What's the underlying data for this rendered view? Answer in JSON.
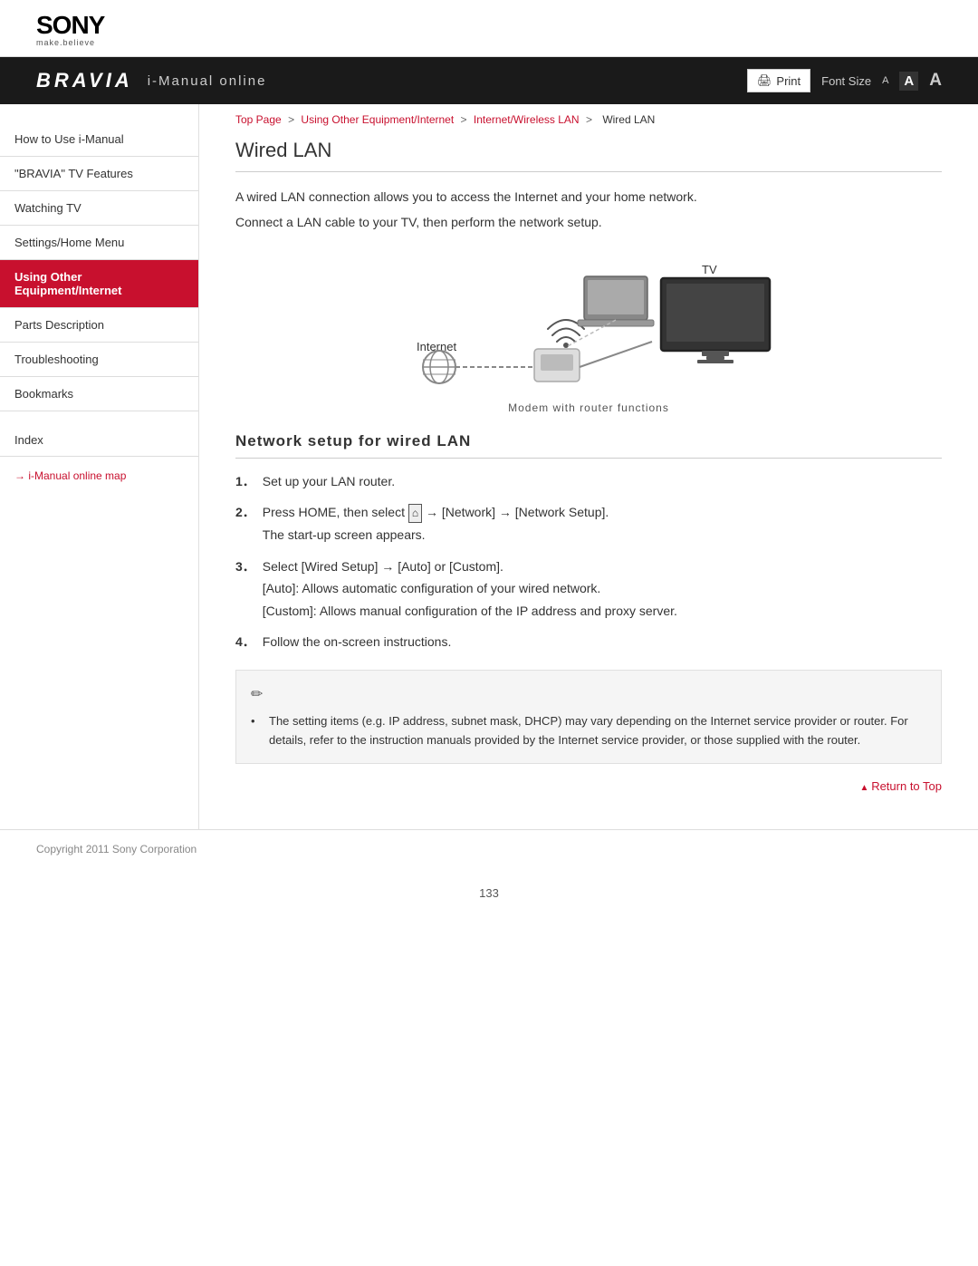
{
  "header": {
    "sony_wordmark": "SONY",
    "sony_tagline": "make.believe"
  },
  "navbar": {
    "bravia_logo": "BRAVIA",
    "title": "i-Manual online",
    "print_label": "Print",
    "font_size_label": "Font Size",
    "font_size_small": "A",
    "font_size_medium": "A",
    "font_size_large": "A"
  },
  "breadcrumb": {
    "top_page": "Top Page",
    "separator1": ">",
    "using_other": "Using Other Equipment/Internet",
    "separator2": ">",
    "internet_wireless": "Internet/Wireless LAN",
    "separator3": ">",
    "current": "Wired LAN"
  },
  "sidebar": {
    "items": [
      {
        "id": "how-to-use",
        "label": "How to Use i-Manual",
        "active": false
      },
      {
        "id": "bravia-features",
        "label": "\"BRAVIA\" TV Features",
        "active": false
      },
      {
        "id": "watching-tv",
        "label": "Watching TV",
        "active": false
      },
      {
        "id": "settings-home",
        "label": "Settings/Home Menu",
        "active": false
      },
      {
        "id": "using-other",
        "label": "Using Other Equipment/Internet",
        "active": true
      },
      {
        "id": "parts-description",
        "label": "Parts Description",
        "active": false
      },
      {
        "id": "troubleshooting",
        "label": "Troubleshooting",
        "active": false
      },
      {
        "id": "bookmarks",
        "label": "Bookmarks",
        "active": false
      }
    ],
    "index_label": "Index",
    "map_link": "→ i-Manual online map"
  },
  "content": {
    "page_title": "Wired LAN",
    "intro1": "A wired LAN connection allows you to access the Internet and your home network.",
    "intro2": "Connect a LAN cable to your TV, then perform the network setup.",
    "diagram": {
      "caption": "Modem with router functions",
      "internet_label": "Internet",
      "tv_label": "TV"
    },
    "section_heading": "Network setup for wired LAN",
    "steps": [
      {
        "num": "1．",
        "text": "Set up your LAN router."
      },
      {
        "num": "2．",
        "text": "Press HOME, then select",
        "sub": "→ [Network] → [Network Setup].\nThe start-up screen appears."
      },
      {
        "num": "3．",
        "text": "Select [Wired Setup] → [Auto] or [Custom].",
        "sub": "[Auto]: Allows automatic configuration of your wired network.\n[Custom]: Allows manual configuration of the IP address and proxy server."
      },
      {
        "num": "4．",
        "text": "Follow the on-screen instructions."
      }
    ],
    "note": {
      "bullet": "The setting items (e.g. IP address, subnet mask, DHCP) may vary depending on the Internet service provider or router. For details, refer to the instruction manuals provided by the Internet service provider, or those supplied with the router."
    },
    "return_to_top": "Return to Top"
  },
  "footer": {
    "copyright": "Copyright 2011 Sony Corporation"
  },
  "page_number": "133"
}
